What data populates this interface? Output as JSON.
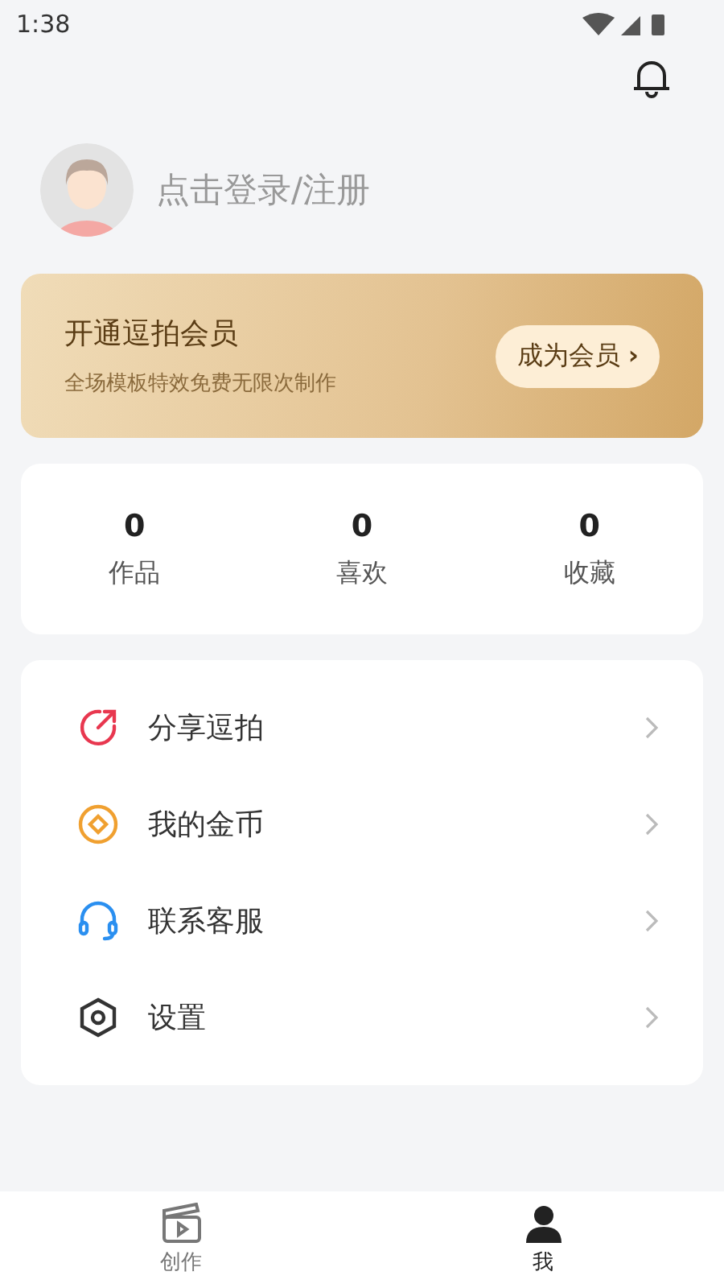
{
  "status_bar": {
    "time": "1:38"
  },
  "profile": {
    "login_prompt": "点击登录/注册"
  },
  "vip_banner": {
    "title": "开通逗拍会员",
    "subtitle": "全场模板特效免费无限次制作",
    "button": "成为会员",
    "button_arrow": "›"
  },
  "stats": [
    {
      "value": "0",
      "label": "作品"
    },
    {
      "value": "0",
      "label": "喜欢"
    },
    {
      "value": "0",
      "label": "收藏"
    }
  ],
  "menu": [
    {
      "kind": "share",
      "label": "分享逗拍",
      "color": "#e8374f"
    },
    {
      "kind": "coin",
      "label": "我的金币",
      "color": "#f0a030"
    },
    {
      "kind": "service",
      "label": "联系客服",
      "color": "#2a8ff0"
    },
    {
      "kind": "settings",
      "label": "设置",
      "color": "#333333"
    }
  ],
  "tab_bar": [
    {
      "kind": "create",
      "label": "创作",
      "selected": false
    },
    {
      "kind": "me",
      "label": "我",
      "selected": true
    }
  ]
}
